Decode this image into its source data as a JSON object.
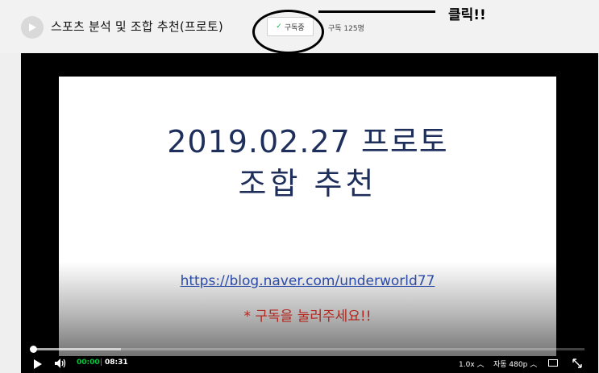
{
  "header": {
    "channel_title": "스포츠 분석 및 조합 추천(프로토)",
    "subscribe_label": "구독중",
    "subscribe_icon": "check-icon",
    "subscriber_count": "구독 125명"
  },
  "annotation": {
    "label": "클릭!!"
  },
  "slide": {
    "title_line1": "2019.02.27 프로토",
    "title_line2": "조합 추천",
    "link": "https://blog.naver.com/underworld77",
    "note": "* 구독을 눌러주세요!!"
  },
  "player": {
    "progress_fraction": 0.0,
    "buffered_fraction": 0.16,
    "current_time": "00:00",
    "separator": "|",
    "total_time": "08:31",
    "speed": "1.0x",
    "quality": "자동 480p",
    "accent_color": "#00c73c"
  }
}
